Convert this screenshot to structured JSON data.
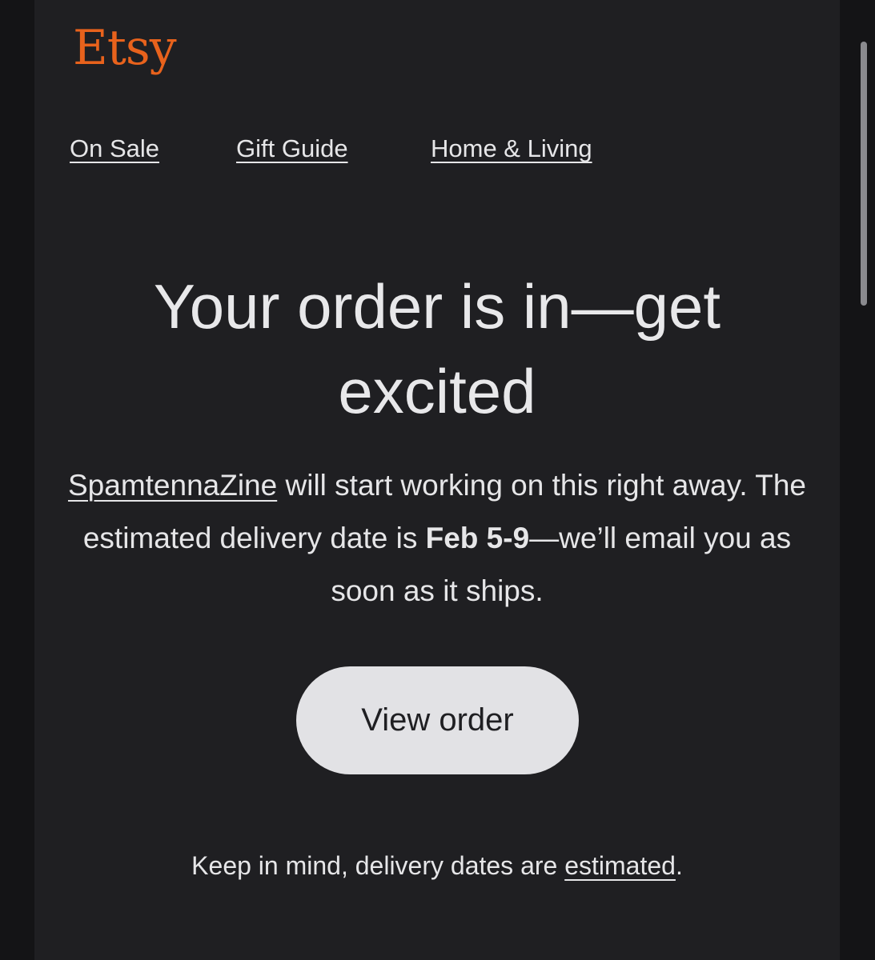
{
  "brand": {
    "logo_text": "Etsy",
    "logo_color": "#e8621c"
  },
  "nav": {
    "items": [
      {
        "label": "On Sale"
      },
      {
        "label": "Gift Guide"
      },
      {
        "label": "Home & Living"
      }
    ]
  },
  "headline": "Your order is in—get excited",
  "message": {
    "shop_name": "SpamtennaZine",
    "text_before_date": " will start working on this right away. The estimated delivery date is ",
    "delivery_date": "Feb 5-9",
    "text_after_date": "—we’ll email you as soon as it ships."
  },
  "cta": {
    "label": "View order"
  },
  "note": {
    "text": "Keep in mind, delivery dates are ",
    "link_label": "estimated",
    "suffix": "."
  },
  "colors": {
    "background": "#1f1f22",
    "outer_background": "#141416",
    "text": "#e6e6e8",
    "button_background": "#e2e2e5"
  }
}
